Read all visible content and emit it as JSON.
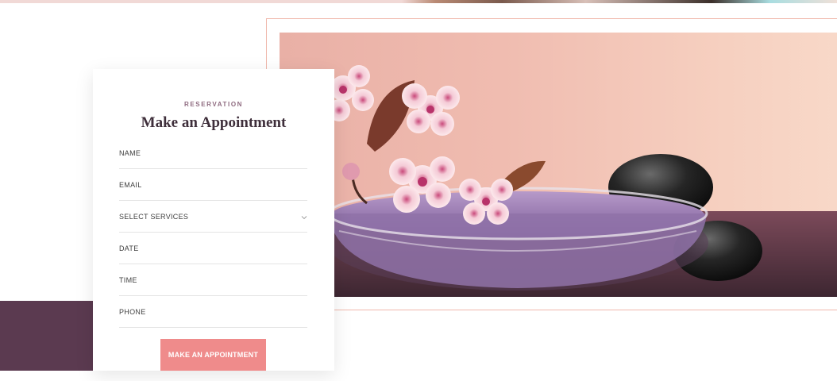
{
  "reservation_form": {
    "eyebrow": "RESERVATION",
    "title": "Make an Appointment",
    "fields": {
      "name": "NAME",
      "email": "EMAIL",
      "select_services": "SELECT SERVICES",
      "date": "DATE",
      "time": "TIME",
      "phone": "PHONE"
    },
    "submit_label": "MAKE AN APPOINTMENT"
  },
  "colors": {
    "accent": "#ef8b8b",
    "brand_dark": "#5b3a50",
    "frame_border": "#f0b8ac"
  },
  "icons": {
    "select_chevron": "chevron-down-icon"
  }
}
